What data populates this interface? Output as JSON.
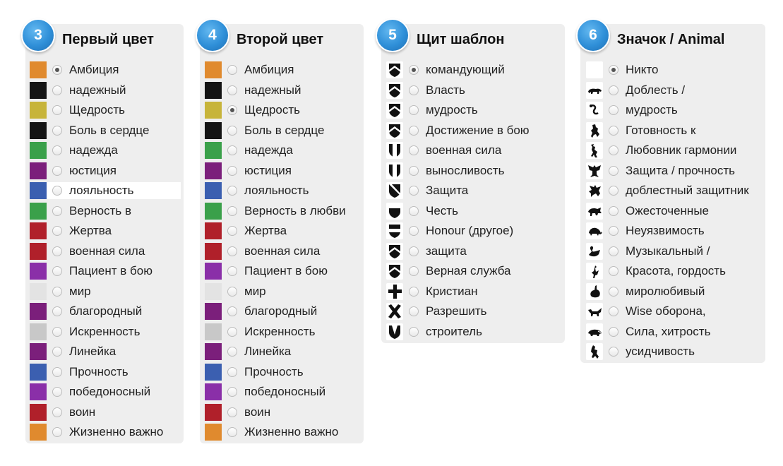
{
  "panels": [
    {
      "step": "3",
      "title": "Первый цвет",
      "selected_index": 0,
      "items": [
        {
          "label": "Амбиция",
          "color": "#e08a2e"
        },
        {
          "label": "надежный",
          "color": "#141414"
        },
        {
          "label": "Щедрость",
          "color": "#c7b43a"
        },
        {
          "label": "Боль в сердце",
          "color": "#141414"
        },
        {
          "label": "надежда",
          "color": "#3aa04a"
        },
        {
          "label": "юстиция",
          "color": "#7b1f7b"
        },
        {
          "label": "лояльность",
          "color": "#3b5fb0"
        },
        {
          "label": "Верность в",
          "color": "#3aa04a"
        },
        {
          "label": "Жертва",
          "color": "#b0202a"
        },
        {
          "label": "военная сила",
          "color": "#b0202a"
        },
        {
          "label": "Пациент в бою",
          "color": "#8a2fa8"
        },
        {
          "label": "мир",
          "color": "#e3e3e3"
        },
        {
          "label": "благородный",
          "color": "#7b1f7b"
        },
        {
          "label": "Искренность",
          "color": "#c8c8c8"
        },
        {
          "label": "Линейка",
          "color": "#7b1f7b"
        },
        {
          "label": "Прочность",
          "color": "#3b5fb0"
        },
        {
          "label": "победоносный",
          "color": "#8a2fa8"
        },
        {
          "label": "воин",
          "color": "#b0202a"
        },
        {
          "label": "Жизненно важно",
          "color": "#e08a2e"
        }
      ]
    },
    {
      "step": "4",
      "title": "Второй цвет",
      "selected_index": 2,
      "items": [
        {
          "label": "Амбиция",
          "color": "#e08a2e"
        },
        {
          "label": "надежный",
          "color": "#141414"
        },
        {
          "label": "Щедрость",
          "color": "#c7b43a"
        },
        {
          "label": "Боль в сердце",
          "color": "#141414"
        },
        {
          "label": "надежда",
          "color": "#3aa04a"
        },
        {
          "label": "юстиция",
          "color": "#7b1f7b"
        },
        {
          "label": "лояльность",
          "color": "#3b5fb0"
        },
        {
          "label": "Верность в любви",
          "color": "#3aa04a"
        },
        {
          "label": "Жертва",
          "color": "#b0202a"
        },
        {
          "label": "военная сила",
          "color": "#b0202a"
        },
        {
          "label": "Пациент в бою",
          "color": "#8a2fa8"
        },
        {
          "label": "мир",
          "color": "#e3e3e3"
        },
        {
          "label": "благородный",
          "color": "#7b1f7b"
        },
        {
          "label": "Искренность",
          "color": "#c8c8c8"
        },
        {
          "label": "Линейка",
          "color": "#7b1f7b"
        },
        {
          "label": "Прочность",
          "color": "#3b5fb0"
        },
        {
          "label": "победоносный",
          "color": "#8a2fa8"
        },
        {
          "label": "воин",
          "color": "#b0202a"
        },
        {
          "label": "Жизненно важно",
          "color": "#e08a2e"
        }
      ]
    },
    {
      "step": "5",
      "title": "Щит шаблон",
      "selected_index": 0,
      "items": [
        {
          "label": "командующий",
          "icon": "shield-chevron-icon"
        },
        {
          "label": "Власть",
          "icon": "shield-chevron-icon"
        },
        {
          "label": "мудрость",
          "icon": "shield-chevron-icon"
        },
        {
          "label": "Достижение в бою",
          "icon": "shield-chevron-icon"
        },
        {
          "label": "военная сила",
          "icon": "shield-pale-icon"
        },
        {
          "label": "выносливость",
          "icon": "shield-pale-icon"
        },
        {
          "label": "Защита",
          "icon": "shield-bend-icon"
        },
        {
          "label": "Честь",
          "icon": "shield-chief-icon"
        },
        {
          "label": "Honour (другое)",
          "icon": "shield-fess-icon"
        },
        {
          "label": "защита",
          "icon": "shield-chevron-icon"
        },
        {
          "label": "Верная служба",
          "icon": "shield-chevron-icon"
        },
        {
          "label": "Кристиан",
          "icon": "shield-cross-icon"
        },
        {
          "label": "Разрешить",
          "icon": "shield-saltire-icon"
        },
        {
          "label": "строитель",
          "icon": "shield-pile-icon"
        }
      ]
    },
    {
      "step": "6",
      "title": "Значок / Animal",
      "selected_index": 0,
      "items": [
        {
          "label": "Никто",
          "icon": "blank-icon"
        },
        {
          "label": "Доблесть /",
          "icon": "bear-icon"
        },
        {
          "label": "мудрость",
          "icon": "serpent-icon"
        },
        {
          "label": "Готовность к",
          "icon": "horse-rampant-icon"
        },
        {
          "label": "Любовник гармонии",
          "icon": "stag-rampant-icon"
        },
        {
          "label": "Защита / прочность",
          "icon": "eagle-icon"
        },
        {
          "label": "доблестный защитник",
          "icon": "griffin-icon"
        },
        {
          "label": "Ожесточенные",
          "icon": "boar-icon"
        },
        {
          "label": "Неуязвимость",
          "icon": "tortoise-icon"
        },
        {
          "label": "Музыкальный /",
          "icon": "swan-icon"
        },
        {
          "label": "Красота, гордость",
          "icon": "peacock-icon"
        },
        {
          "label": "миролюбивый",
          "icon": "rabbit-icon"
        },
        {
          "label": "Wise оборона,",
          "icon": "fox-icon"
        },
        {
          "label": "Сила, хитрость",
          "icon": "badger-icon"
        },
        {
          "label": "усидчивость",
          "icon": "dog-icon"
        }
      ]
    }
  ]
}
